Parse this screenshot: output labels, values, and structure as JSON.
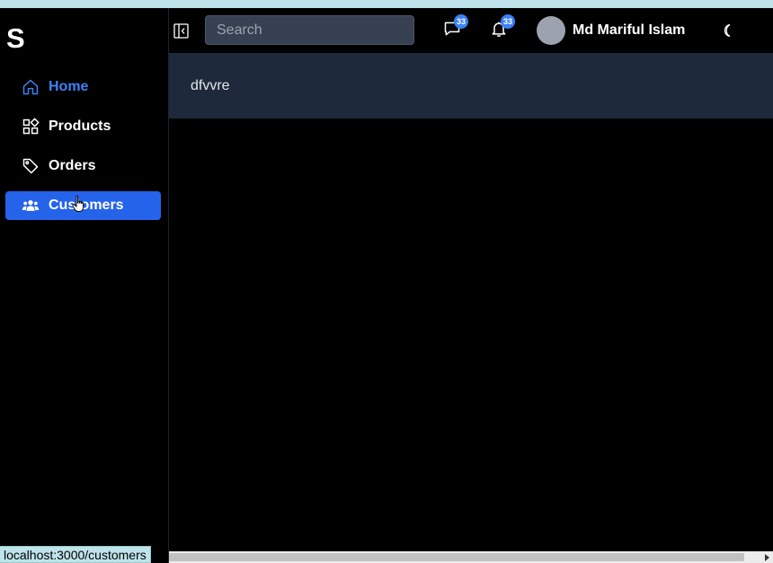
{
  "logo": "S",
  "nav": {
    "home": "Home",
    "products": "Products",
    "orders": "Orders",
    "customers": "Customers"
  },
  "search": {
    "placeholder": "Search"
  },
  "header": {
    "messages_count": "33",
    "notifications_count": "33",
    "user_name": "Md Mariful Islam"
  },
  "content": {
    "text": "dfvvre"
  },
  "status": {
    "url": "localhost:3000/customers"
  },
  "colors": {
    "accent": "#2563eb",
    "link": "#3b82f6",
    "panel": "#1e293b"
  }
}
